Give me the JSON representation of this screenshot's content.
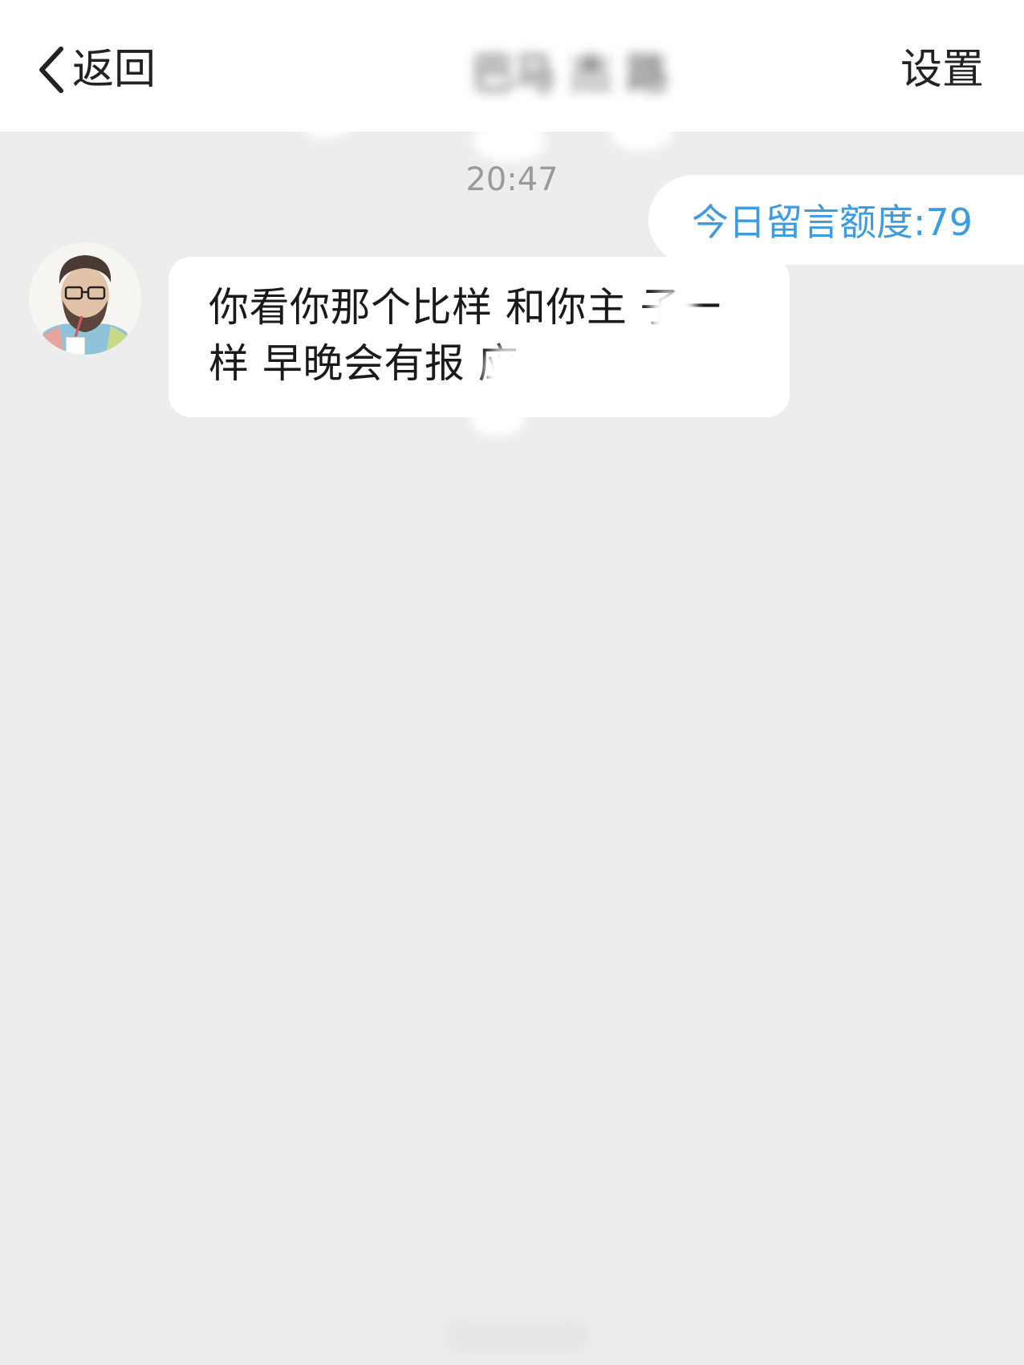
{
  "header": {
    "back_label": "返回",
    "back_icon": "chevron-left-icon",
    "title": "巴马 杰 路 ",
    "settings_label": "设置"
  },
  "conversation": {
    "timestamp": "20:47",
    "quota_text": "今日留言额度:79",
    "messages": [
      {
        "sender": "other",
        "text": "你看你那个比样 和你主 子一样 早晚会有报 应"
      }
    ]
  },
  "colors": {
    "background": "#ededed",
    "header_bg": "#ffffff",
    "bubble_bg": "#ffffff",
    "quota_text": "#3d9be0",
    "timestamp": "#9a9a9a"
  }
}
